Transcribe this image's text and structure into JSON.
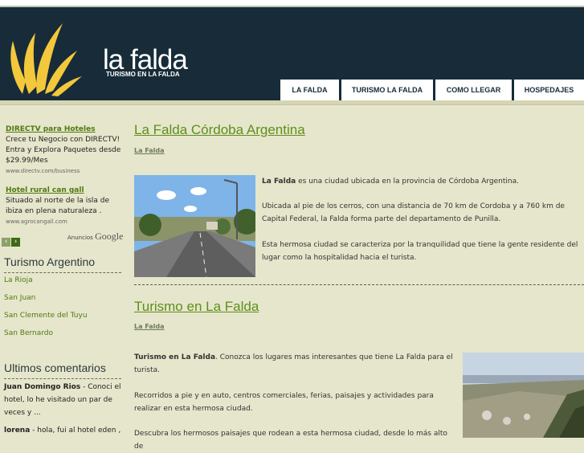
{
  "header": {
    "site_title": "la falda",
    "site_subtitle": "TURISMO EN LA FALDA",
    "colors": {
      "background": "#172c38",
      "logo_flame": "#f4c83c"
    },
    "nav": [
      "LA FALDA",
      "TURISMO LA FALDA",
      "COMO LLEGAR",
      "HOSPEDAJES"
    ]
  },
  "ads": {
    "items": [
      {
        "title": "DIRECTV para Hoteles",
        "text": "Crece tu Negocio con DIRECTV! Entra y Explora Paquetes desde $29.99/Mes",
        "url": "www.directv.com/business"
      },
      {
        "title": "Hotel rural can gall",
        "text": "Situado al norte de la isla de ibiza en plena naturaleza .",
        "url": "www.agrocangall.com"
      }
    ],
    "prev_icon": "chevron-left-icon",
    "next_icon": "chevron-right-icon",
    "ads_by_label": "Anuncios",
    "ads_by_brand": "Google"
  },
  "sidebar": {
    "turismo_heading": "Turismo Argentino",
    "links": [
      "La Rioja",
      "San Juan",
      "San Clemente del Tuyu",
      "San Bernardo"
    ],
    "comments_heading": "Ultimos comentarios",
    "comments": [
      {
        "author": "Juan Domingo Rios",
        "text": " - Conoci el hotel, lo he visitado un par de veces y ..."
      },
      {
        "author": "lorena",
        "text": " - hola, fui al hotel eden ,"
      }
    ]
  },
  "main": {
    "article1": {
      "title": "La Falda Córdoba Argentina",
      "category": "La Falda",
      "image_alt": "street-photo",
      "bold_lead": "La Falda",
      "p1_rest": " es una ciudad ubicada en la provincia de Córdoba Argentina.",
      "p2": "Ubicada al pie de los cerros, con una distancia de 70 km de Cordoba y a 760 km de Capital Federal, la Falda forma parte del departamento de Punilla.",
      "p3": "Esta hermosa ciudad se caracteriza por la tranquilidad que tiene la gente residente del lugar como la hospitalidad hacia el turista."
    },
    "article2": {
      "title": "Turismo en La Falda",
      "category": "La Falda",
      "image_alt": "valley-photo",
      "bold_lead": "Turismo en La Falda",
      "p1_rest": ". Conozca los lugares mas interesantes que tiene La Falda para el turista.",
      "p2": "Recorridos a pie y en auto, centros comerciales, ferias, paisajes y actividades para realizar en esta hermosa ciudad.",
      "p3": "Descubra los hermosos paisajes que rodean a esta hermosa ciudad, desde lo más alto de"
    }
  }
}
